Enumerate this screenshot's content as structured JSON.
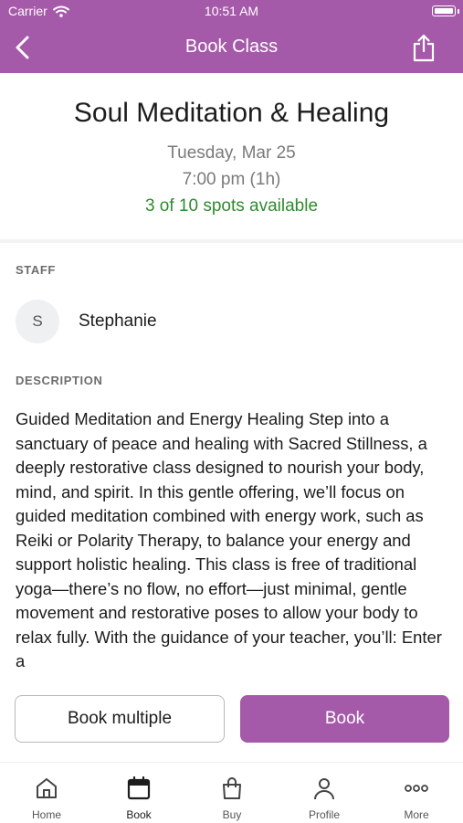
{
  "status_bar": {
    "carrier": "Carrier",
    "time": "10:51 AM"
  },
  "nav": {
    "title": "Book Class",
    "back_icon": "chevron-left-icon",
    "share_icon": "share-icon"
  },
  "class_info": {
    "title": "Soul Meditation & Healing",
    "date": "Tuesday, Mar 25",
    "time": "7:00 pm (1h)",
    "availability": "3 of 10 spots available"
  },
  "staff": {
    "section_label": "STAFF",
    "avatar_initial": "S",
    "name": "Stephanie"
  },
  "description": {
    "section_label": "DESCRIPTION",
    "text": "Guided Meditation and Energy Healing Step into a sanctuary of peace and healing with Sacred Stillness, a deeply restorative class designed to nourish your body, mind, and spirit. In this gentle offering, we’ll focus on guided meditation combined with energy work, such as Reiki or Polarity Therapy, to balance your energy and support holistic healing. This class is free of traditional yoga—there’s no flow, no effort—just minimal, gentle movement and restorative poses to allow your body to relax fully. With the guidance of your teacher, you’ll: Enter a"
  },
  "actions": {
    "book_multiple_label": "Book multiple",
    "book_label": "Book"
  },
  "tabbar": {
    "items": [
      {
        "label": "Home",
        "icon": "home-icon"
      },
      {
        "label": "Book",
        "icon": "calendar-icon"
      },
      {
        "label": "Buy",
        "icon": "shopping-bag-icon"
      },
      {
        "label": "Profile",
        "icon": "person-icon"
      },
      {
        "label": "More",
        "icon": "more-dots-icon"
      }
    ],
    "active": "Book"
  },
  "colors": {
    "brand": "#a55aa9",
    "availability": "#2e8b2e"
  }
}
